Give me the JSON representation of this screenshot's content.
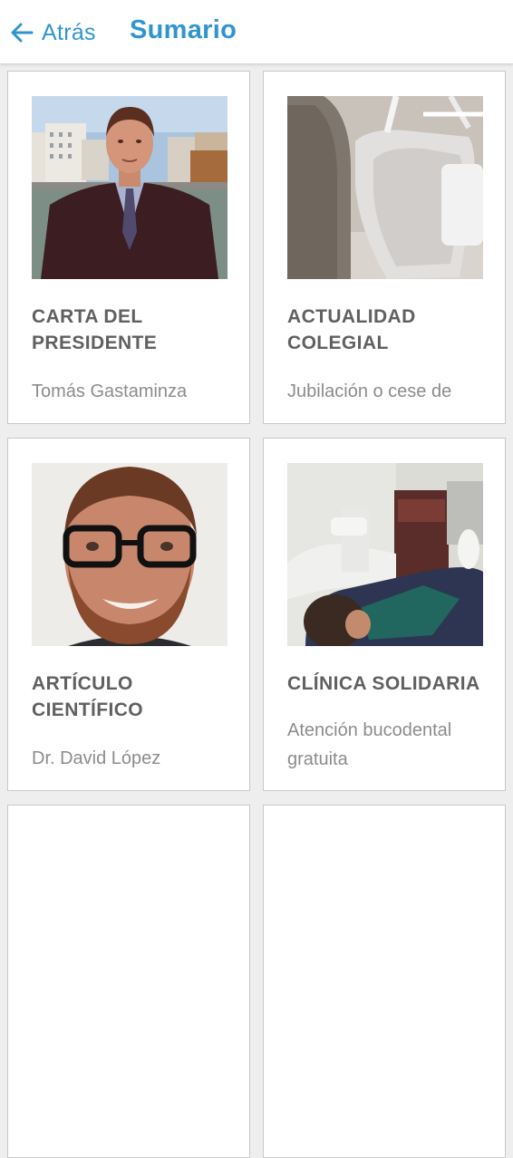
{
  "header": {
    "back_label": "Atrás",
    "title": "Sumario"
  },
  "cards": [
    {
      "title": "CARTA DEL PRESIDENTE",
      "subtitle": "Tomás Gastaminza"
    },
    {
      "title": "ACTUALIDAD COLEGIAL",
      "subtitle": "Jubilación o cese de"
    },
    {
      "title": "ARTÍCULO CIENTÍFICO",
      "subtitle": "Dr. David López"
    },
    {
      "title": "CLÍNICA SOLIDARIA",
      "subtitle": "Atención bucodental gratuita"
    }
  ],
  "colors": {
    "accent": "#2f95cf",
    "card_title": "#606060",
    "card_subtitle": "#8c8c8c"
  }
}
